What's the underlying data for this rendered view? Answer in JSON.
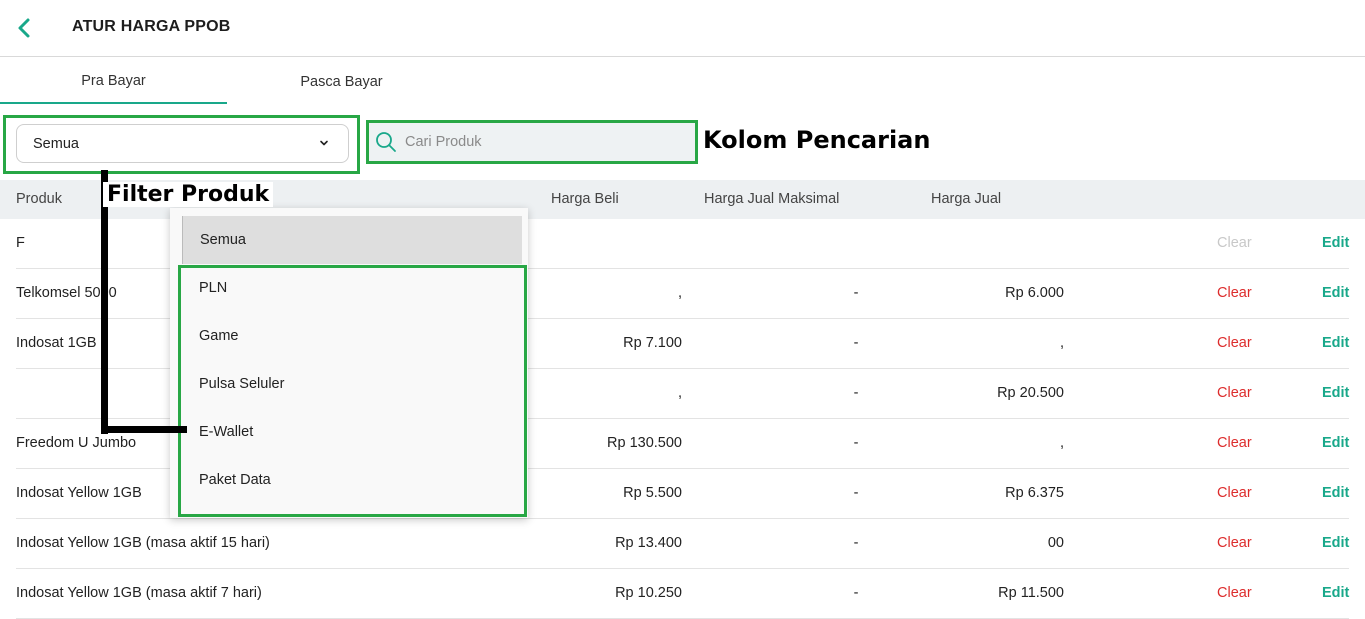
{
  "header": {
    "title": "ATUR HARGA PPOB",
    "back_icon": "chevron-left-icon",
    "accent": "#19a88a"
  },
  "tabs": [
    {
      "label": "Pra Bayar",
      "active": true
    },
    {
      "label": "Pasca Bayar",
      "active": false
    }
  ],
  "filter": {
    "selected": "Semua",
    "icon": "chevron-down-icon"
  },
  "search": {
    "placeholder": "Cari Produk",
    "value": "",
    "icon": "search-icon"
  },
  "annotations": {
    "search_label": "Kolom Pencarian",
    "filter_label": "Filter Produk",
    "highlight_color": "#28a745"
  },
  "table": {
    "headers": {
      "produk": "Produk",
      "harga_beli": "Harga Beli",
      "harga_jual_maks": "Harga Jual Maksimal",
      "harga_jual": "Harga Jual"
    },
    "rows": [
      {
        "produk": "F",
        "harga_beli": "",
        "harga_jual_maks": "",
        "harga_jual": "",
        "clear": "Clear",
        "edit": "Edit"
      },
      {
        "produk": "Telkomsel 5000",
        "harga_beli": ",",
        "harga_jual_maks": "-",
        "harga_jual": "Rp 6.000",
        "clear": "Clear",
        "edit": "Edit"
      },
      {
        "produk": "Indosat 1GB",
        "harga_beli": "Rp 7.100",
        "harga_jual_maks": "-",
        "harga_jual": ",",
        "clear": "Clear",
        "edit": "Edit"
      },
      {
        "produk": "",
        "harga_beli": ",",
        "harga_jual_maks": "-",
        "harga_jual": "Rp 20.500",
        "clear": "Clear",
        "edit": "Edit"
      },
      {
        "produk": "Freedom U Jumbo",
        "harga_beli": "Rp 130.500",
        "harga_jual_maks": "-",
        "harga_jual": ",",
        "clear": "Clear",
        "edit": "Edit"
      },
      {
        "produk": "Indosat Yellow 1GB",
        "harga_beli": "Rp 5.500",
        "harga_jual_maks": "-",
        "harga_jual": "Rp 6.375",
        "clear": "Clear",
        "edit": "Edit"
      },
      {
        "produk": "Indosat Yellow 1GB (masa aktif 15 hari)",
        "harga_beli": "Rp 13.400",
        "harga_jual_maks": "-",
        "harga_jual": "00",
        "clear": "Clear",
        "edit": "Edit"
      },
      {
        "produk": "Indosat Yellow 1GB (masa aktif 7 hari)",
        "harga_beli": "Rp 10.250",
        "harga_jual_maks": "-",
        "harga_jual": "Rp 11.500",
        "clear": "Clear",
        "edit": "Edit"
      }
    ]
  },
  "dropdown": {
    "options": [
      "Semua",
      "PLN",
      "Game",
      "Pulsa Seluler",
      "E-Wallet",
      "Paket Data"
    ]
  }
}
